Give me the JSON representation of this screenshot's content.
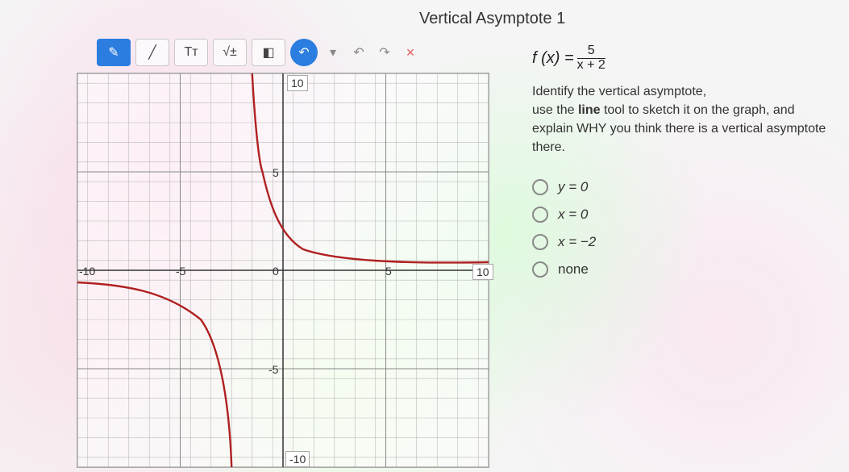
{
  "title": "Vertical Asymptote 1",
  "toolbar": {
    "pen_icon": "✎",
    "line_icon": "╱",
    "text_label": "Tᴛ",
    "math_label": "√±",
    "eraser_icon": "◧",
    "undo_icon": "↶",
    "dropdown_icon": "▾",
    "undo2_icon": "↶",
    "redo_icon": "↷",
    "close_icon": "×"
  },
  "equation": {
    "lhs": "f (x) =",
    "num": "5",
    "den": "x + 2"
  },
  "instructions": {
    "l1": "Identify the vertical asymptote,",
    "l2_a": "use the ",
    "l2_b": "line",
    "l2_c": " tool to sketch it on the graph, and",
    "l3": "explain WHY you think there is a vertical asymptote there."
  },
  "options": {
    "o1": "y = 0",
    "o2": "x = 0",
    "o3": "x = −2",
    "o4": "none"
  },
  "axis": {
    "ylabel_top": "10",
    "ylabel_5": "5",
    "ylabel_0": "0",
    "ylabel_neg5": "-5",
    "ylabel_bot": "-10",
    "xlabel_neg10": "-10",
    "xlabel_neg5": "-5",
    "xlabel_5": "5",
    "xlabel_10": "10"
  },
  "chart_data": {
    "type": "line",
    "title": "f(x) = 5 / (x + 2)",
    "xlim": [
      -10,
      10
    ],
    "ylim": [
      -10,
      10
    ],
    "vertical_asymptote": -2,
    "horizontal_asymptote": 0,
    "series": [
      {
        "name": "f(x) right branch",
        "x": [
          -1.5,
          -1,
          0,
          1,
          2,
          3,
          5,
          8,
          10
        ],
        "y": [
          10,
          5,
          2.5,
          1.67,
          1.25,
          1,
          0.71,
          0.5,
          0.42
        ]
      },
      {
        "name": "f(x) left branch",
        "x": [
          -10,
          -8,
          -6,
          -4,
          -3,
          -2.5
        ],
        "y": [
          -0.63,
          -0.83,
          -1.25,
          -2.5,
          -5,
          -10
        ]
      }
    ]
  }
}
